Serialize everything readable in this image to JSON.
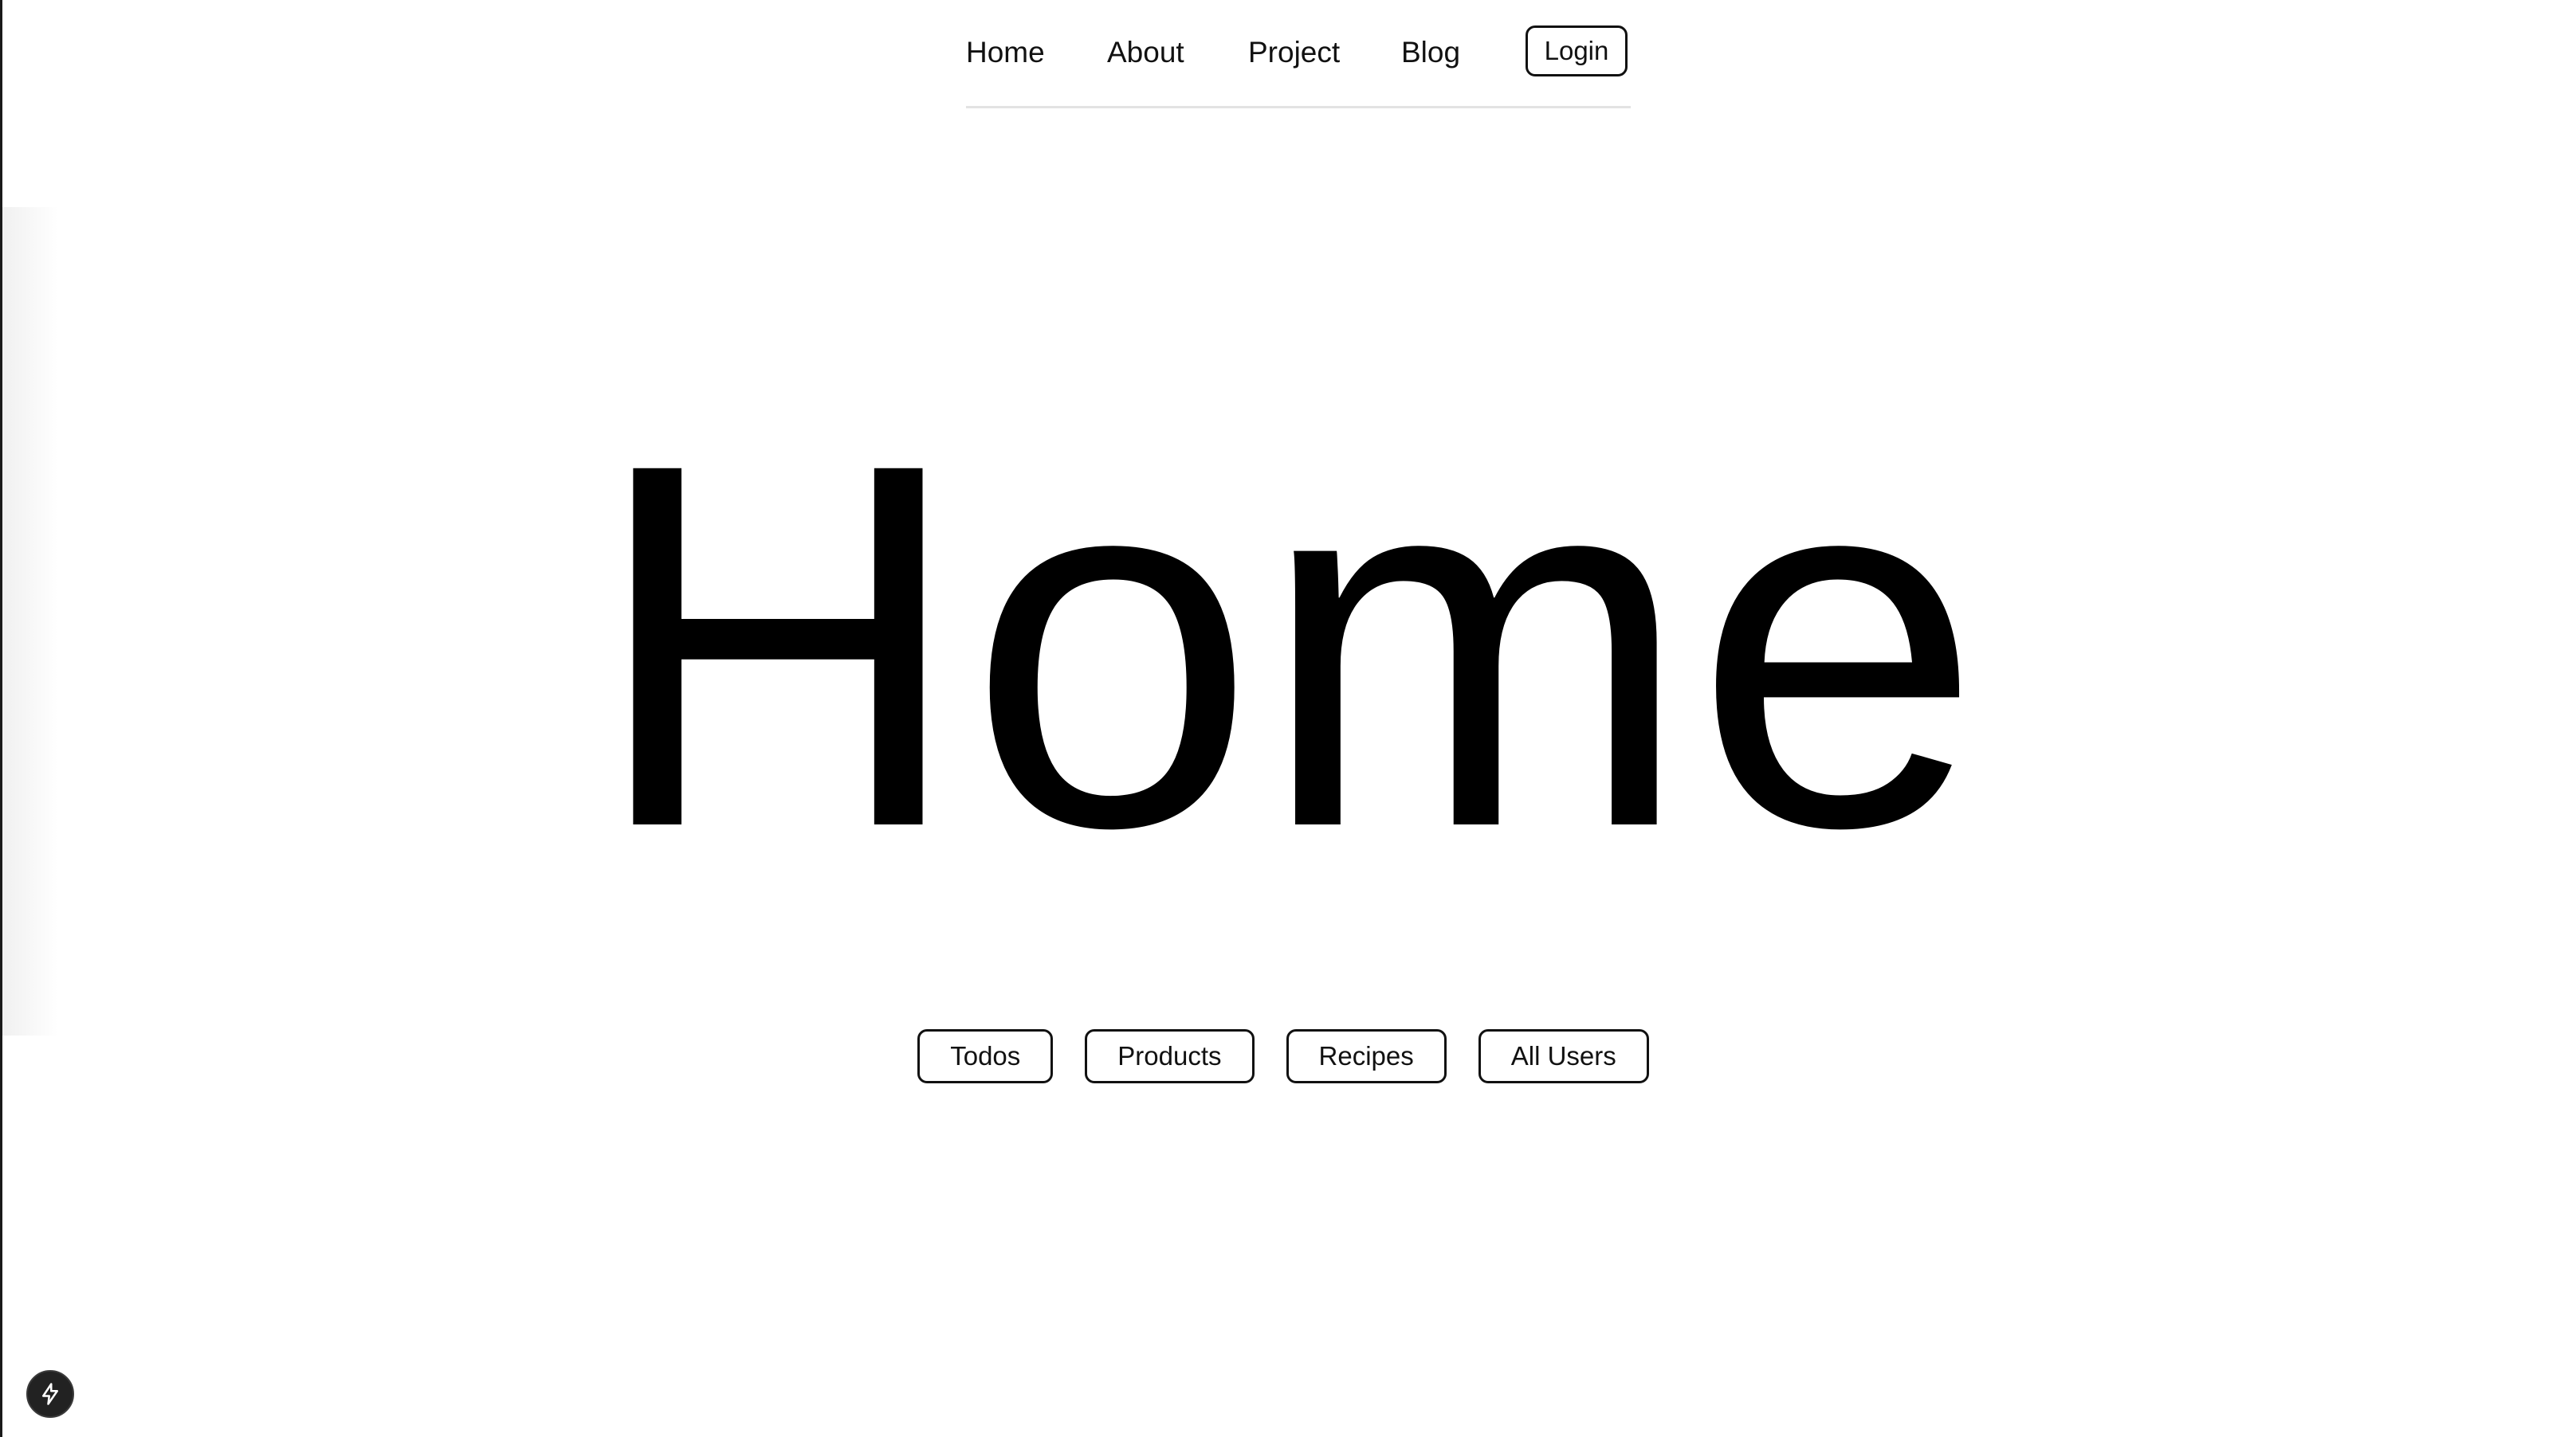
{
  "nav": {
    "items": [
      {
        "label": "Home"
      },
      {
        "label": "About"
      },
      {
        "label": "Project"
      },
      {
        "label": "Blog"
      }
    ],
    "login_label": "Login"
  },
  "hero": {
    "title": "Home"
  },
  "links": {
    "items": [
      {
        "label": "Todos"
      },
      {
        "label": "Products"
      },
      {
        "label": "Recipes"
      },
      {
        "label": "All Users"
      }
    ]
  },
  "floating": {
    "icon": "lightning-bolt-icon"
  },
  "colors": {
    "background": "#ffffff",
    "text": "#000000",
    "border": "#111111",
    "divider": "#e3e3e3",
    "floating_button": "#222222"
  }
}
